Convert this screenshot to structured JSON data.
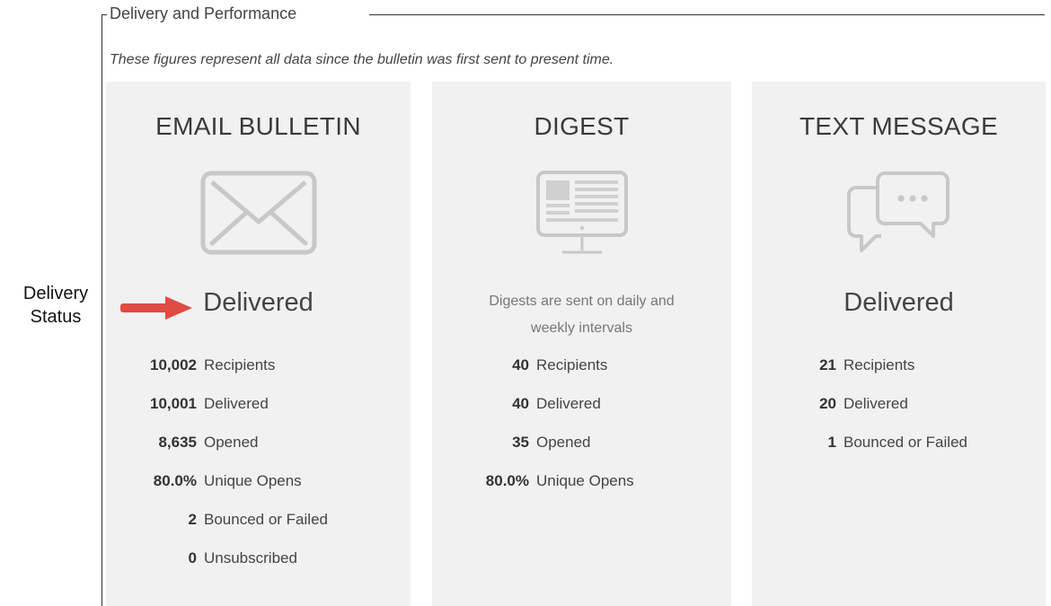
{
  "section": {
    "legend": "Delivery and Performance",
    "subtitle": "These figures represent all data since the bulletin was first sent to present time."
  },
  "annotation": {
    "line1": "Delivery",
    "line2": "Status",
    "arrow_color": "#e04b43"
  },
  "panels": {
    "email": {
      "title": "EMAIL BULLETIN",
      "icon": "envelope-icon",
      "status": "Delivered",
      "stats": [
        {
          "value": "10,002",
          "label": "Recipients"
        },
        {
          "value": "10,001",
          "label": "Delivered"
        },
        {
          "value": "8,635",
          "label": "Opened"
        },
        {
          "value": "80.0%",
          "label": "Unique Opens"
        },
        {
          "value": "2",
          "label": "Bounced or Failed"
        },
        {
          "value": "0",
          "label": "Unsubscribed"
        }
      ]
    },
    "digest": {
      "title": "DIGEST",
      "icon": "monitor-icon",
      "note_line1": "Digests are sent on daily and",
      "note_line2": "weekly intervals",
      "stats": [
        {
          "value": "40",
          "label": "Recipients"
        },
        {
          "value": "40",
          "label": "Delivered"
        },
        {
          "value": "35",
          "label": "Opened"
        },
        {
          "value": "80.0%",
          "label": "Unique Opens"
        }
      ]
    },
    "text": {
      "title": "TEXT MESSAGE",
      "icon": "chat-bubbles-icon",
      "status": "Delivered",
      "stats": [
        {
          "value": "21",
          "label": "Recipients"
        },
        {
          "value": "20",
          "label": "Delivered"
        },
        {
          "value": "1",
          "label": "Bounced or Failed"
        }
      ]
    }
  },
  "colors": {
    "panel_bg": "#f1f1f1",
    "icon_stroke": "#c8c8c8"
  }
}
